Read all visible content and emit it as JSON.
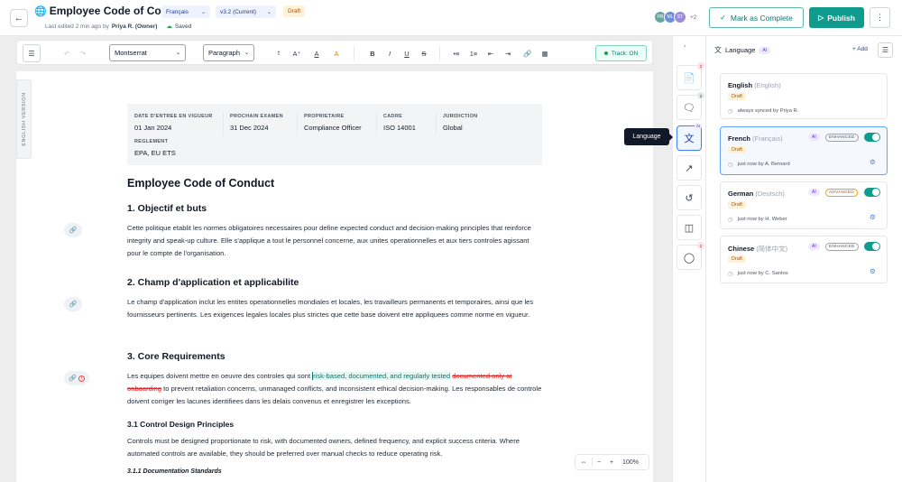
{
  "header": {
    "title": "Employee Code of Conduct",
    "language_select": "Français",
    "version_select": "v3.2 (Current)",
    "status": "Draft",
    "last_edited_prefix": "Last edited 2 min ago by",
    "last_edited_by": "Priya R. (Owner)",
    "saved": "Saved",
    "avatars": [
      {
        "initials": "PR",
        "color": "#6aa5a0"
      },
      {
        "initials": "ML",
        "color": "#6b8fd6"
      },
      {
        "initials": "ST",
        "color": "#9b8bd8"
      }
    ],
    "avatar_more": "+2",
    "mark_complete_label": "Mark as Complete",
    "publish_label": "Publish"
  },
  "toolbar": {
    "font": "Montserrat",
    "block_style": "Paragraph",
    "track_label": "Track: ON"
  },
  "document": {
    "side_tab": "ENGLISH VERSION",
    "meta": [
      {
        "label": "DATE D'ENTREE EN VIGUEUR",
        "value": "01 Jan 2024"
      },
      {
        "label": "PROCHAIN EXAMEN",
        "value": "31 Dec 2024"
      },
      {
        "label": "PROPRIETAIRE",
        "value": "Compliance Officer"
      },
      {
        "label": "CADRE",
        "value": "ISO 14001"
      },
      {
        "label": "JURIDICTION",
        "value": "Global"
      },
      {
        "label": "REGLEMENT",
        "value": "EPA, EU ETS"
      }
    ],
    "title": "Employee Code of Conduct",
    "s1_heading": "1. Objectif et buts",
    "s1_body": "Cette politique etablit les normes obligatoires necessaires pour define expected conduct and decision-making principles that reinforce integrity and speak-up culture. Elle s'applique a tout le personnel concerne, aux unites operationnelles et aux tiers controles agissant pour le compte de l'organisation.",
    "s2_heading": "2. Champ d'application et applicabilite",
    "s2_body": "Le champ d'application inclut les entites operationnelles mondiales et locales, les travailleurs permanents et temporaires, ainsi que les fournisseurs pertinents. Les exigences legales locales plus strictes que cette base doivent etre appliquees comme norme en vigueur.",
    "s3_heading": "3. Core Requirements",
    "s3_body_before": "Les equipes doivent mettre en oeuvre des controles qui sont ",
    "s3_inserted": "risk-based, documented, and regularly tested",
    "s3_deleted": "documented only at onboarding",
    "s3_body_after": " to prevent retaliation concerns, unmanaged conflicts, and inconsistent ethical decision-making. Les responsables de controle doivent corriger les lacunes identifiees dans les delais convenus et enregistrer les exceptions.",
    "s31_heading": "3.1 Control Design Principles",
    "s31_body": "Controls must be designed proportionate to risk, with documented owners, defined frequency, and explicit success criteria. Where automated controls are available, they should be preferred over manual checks to reduce operating risk.",
    "s311_heading": "3.1.1 Documentation Standards"
  },
  "zoom": {
    "level": "100%"
  },
  "rail": {
    "badges": {
      "document": "2",
      "comments": "2",
      "shield": "2"
    },
    "ai_tag": "AI",
    "tooltip": "Language"
  },
  "panel": {
    "title": "Language",
    "ai_tag": "AI",
    "add_label": "+ Add",
    "languages": [
      {
        "name": "English",
        "native": "(English)",
        "status": "Draft",
        "meta": "always synced by Priya R.",
        "ai": "",
        "level": "",
        "toggle": false
      },
      {
        "name": "French",
        "native": "(Français)",
        "status": "Draft",
        "meta": "just now by A. Bernard",
        "ai": "AI",
        "level": "ENHANCED",
        "toggle": true
      },
      {
        "name": "German",
        "native": "(Deutsch)",
        "status": "Draft",
        "meta": "just now by H. Weber",
        "ai": "AI",
        "level": "ADVANCED",
        "toggle": true
      },
      {
        "name": "Chinese",
        "native": "(简体中文)",
        "status": "Draft",
        "meta": "just now by C. Santos",
        "ai": "AI",
        "level": "ENHANCED",
        "toggle": true
      }
    ]
  },
  "colors": {
    "brand_teal": "#0f9b8e",
    "draft_bg": "#fdf1d8",
    "active_border": "#60a5fa",
    "ai_purple": "#6d28d9"
  }
}
